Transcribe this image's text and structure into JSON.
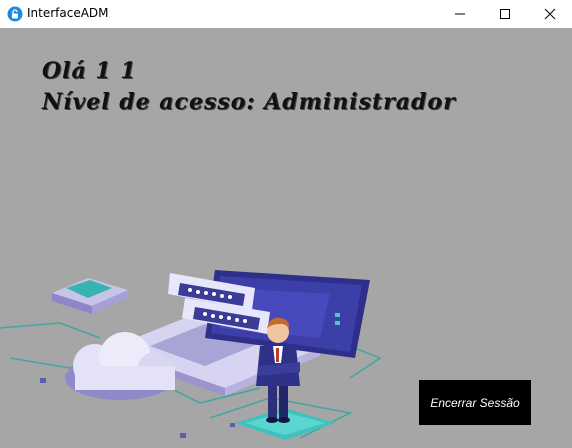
{
  "window": {
    "title": "InterfaceADM",
    "app_icon": "app-lock-icon",
    "controls": [
      "minimize-icon",
      "maximize-icon",
      "close-icon"
    ]
  },
  "main": {
    "greeting": "Olá 1 1",
    "access_level": "Nível de acesso: Administrador",
    "logout_label": "Encerrar Sessão",
    "illustration": "admin-laptop-cloud-illustration"
  },
  "colors": {
    "background": "#a6a6a6",
    "button_bg": "#000000",
    "button_text": "#ffffff",
    "title_bar": "#ffffff"
  }
}
